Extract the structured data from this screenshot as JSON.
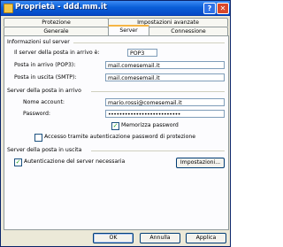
{
  "window": {
    "title": "Proprietà - ddd.mm.it",
    "help_button": "?",
    "close_button": "✕"
  },
  "tabs": {
    "row1": [
      "Protezione",
      "Impostazioni avanzate"
    ],
    "row2": [
      "Generale",
      "Server",
      "Connessione"
    ],
    "active": "Server"
  },
  "server_info": {
    "heading": "Informazioni sul server",
    "incoming_type_label": "Il server della posta in arrivo è:",
    "incoming_type_value": "POP3",
    "incoming_label": "Posta in arrivo (POP3):",
    "incoming_value": "mail.comesemail.it",
    "outgoing_label": "Posta in uscita (SMTP):",
    "outgoing_value": "mail.comesemail.it"
  },
  "incoming_server": {
    "heading": "Server della posta in arrivo",
    "account_label": "Nome account:",
    "account_value": "mario.rossi@comesemail.it",
    "password_label": "Password:",
    "password_value": "••••••••••••••••••••••••••",
    "remember_label": "Memorizza password",
    "remember_checked": true,
    "spa_label": "Accesso tramite autenticazione password di protezione",
    "spa_checked": false
  },
  "outgoing_server": {
    "heading": "Server della posta in uscita",
    "auth_label": "Autenticazione del server necessaria",
    "auth_checked": true,
    "settings_button": "Impostazioni..."
  },
  "footer": {
    "ok": "OK",
    "cancel": "Annulla",
    "apply": "Applica"
  }
}
